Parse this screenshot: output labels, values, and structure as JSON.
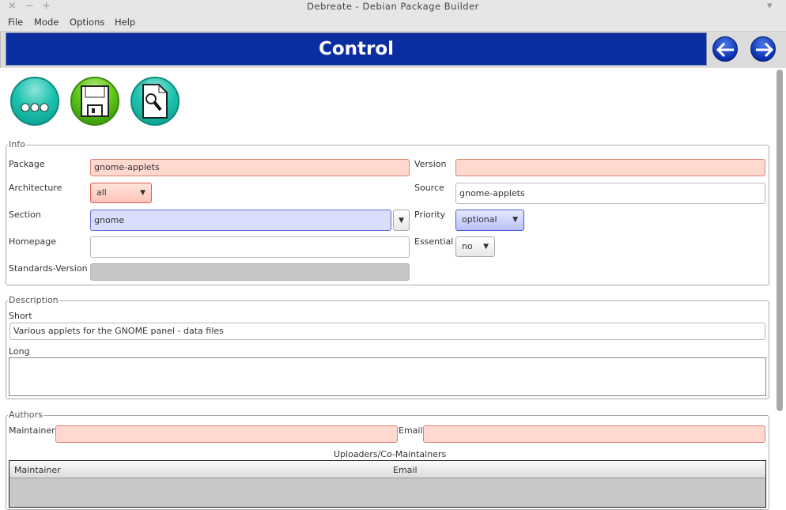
{
  "window": {
    "title": "Debreate - Debian Package Builder",
    "close": "×",
    "minimize": "−",
    "maximize": "+",
    "menu_arrow": "▾"
  },
  "menubar": [
    "File",
    "Mode",
    "Options",
    "Help"
  ],
  "banner": {
    "title": "Control",
    "back_icon": "arrow-left-icon",
    "forward_icon": "arrow-right-icon"
  },
  "toolbar": [
    {
      "icon": "more-options-icon"
    },
    {
      "icon": "save-floppy-icon"
    },
    {
      "icon": "preview-file-icon"
    }
  ],
  "info": {
    "legend": "Info",
    "package": {
      "label": "Package",
      "value": "gnome-applets"
    },
    "architecture": {
      "label": "Architecture",
      "value": "all"
    },
    "section": {
      "label": "Section",
      "value": "gnome"
    },
    "homepage": {
      "label": "Homepage",
      "value": ""
    },
    "standards_version": {
      "label": "Standards-Version",
      "value": ""
    },
    "version": {
      "label": "Version",
      "value": ""
    },
    "source": {
      "label": "Source",
      "value": "gnome-applets"
    },
    "priority": {
      "label": "Priority",
      "value": "optional"
    },
    "essential": {
      "label": "Essential",
      "value": "no"
    }
  },
  "description": {
    "legend": "Description",
    "short_label": "Short",
    "short_value": "Various applets for the GNOME panel - data files",
    "long_label": "Long",
    "long_value": ""
  },
  "authors": {
    "legend": "Authors",
    "maintainer_label": "Maintainer",
    "email_label": "Email",
    "uploaders_label": "Uploaders/Co-Maintainers",
    "columns": [
      "Maintainer",
      "Email"
    ]
  },
  "arrow": "▼"
}
